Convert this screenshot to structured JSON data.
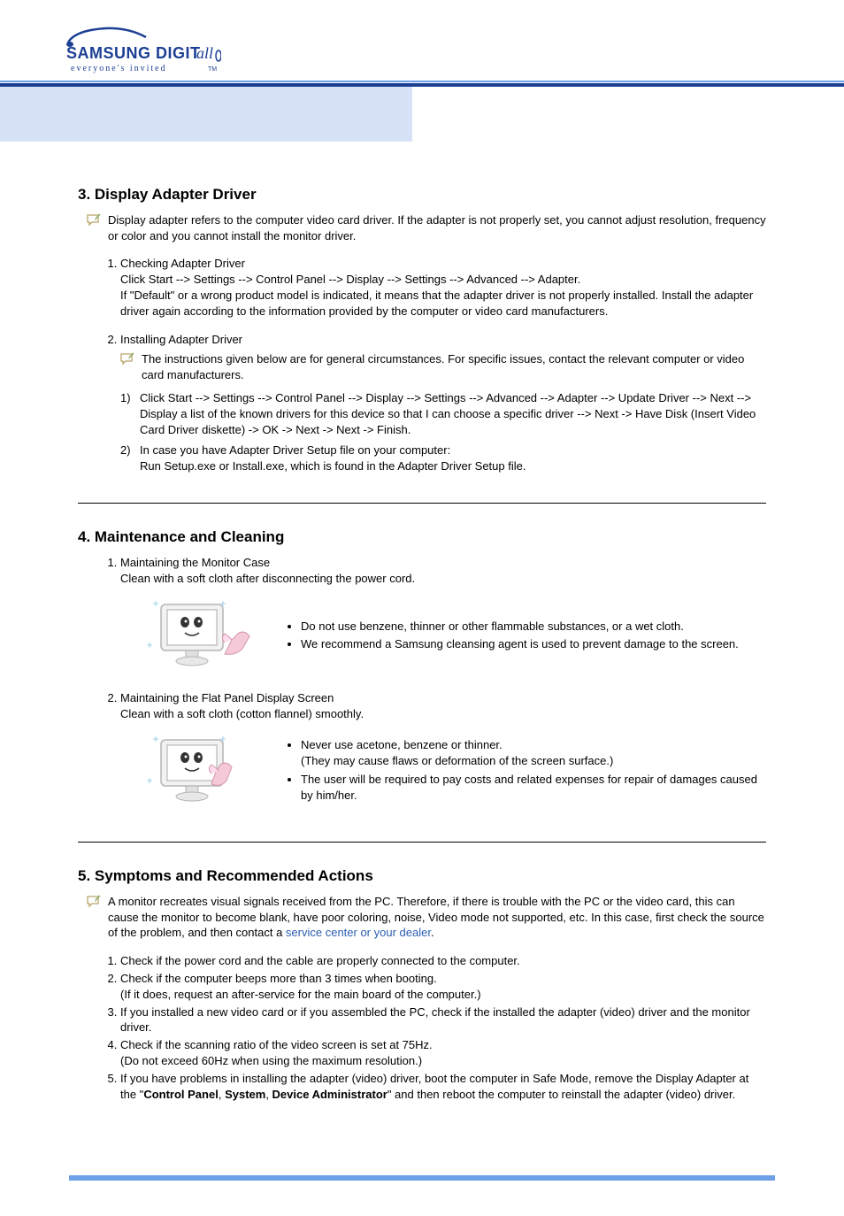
{
  "brand": {
    "line1": "SAMSUNG DIGIT",
    "line2_ital": "all",
    "tagline": "everyone's invited™"
  },
  "section3": {
    "title": "3. Display Adapter Driver",
    "note": "Display adapter refers to the computer video card driver. If the adapter is not properly set, you cannot adjust resolution, frequency or color and you cannot install the monitor driver.",
    "item1_title": "Checking Adapter Driver",
    "item1_body": "Click Start --> Settings --> Control Panel --> Display --> Settings --> Advanced --> Adapter.\nIf \"Default\" or a wrong product model is indicated, it means that the adapter driver is not properly installed. Install the adapter driver again according to the information provided by the computer or video card manufacturers.",
    "item2_title": "Installing Adapter Driver",
    "sub_note": "The instructions given below are for general circumstances. For specific issues, contact the relevant computer or video card manufacturers.",
    "step1": "Click Start --> Settings --> Control Panel --> Display --> Settings --> Advanced --> Adapter --> Update Driver --> Next --> Display a list of the known drivers for this device so that I can choose a specific driver --> Next -> Have Disk (Insert Video Card Driver diskette) -> OK -> Next -> Next -> Finish.",
    "step2": "In case you have Adapter Driver Setup file on your computer:\nRun Setup.exe or Install.exe, which is found in the Adapter Driver Setup file."
  },
  "section4": {
    "title": "4. Maintenance and Cleaning",
    "item1_title": "Maintaining the Monitor Case",
    "item1_body": "Clean with a soft cloth after disconnecting the power cord.",
    "bullets1": [
      "Do not use benzene, thinner or other flammable substances, or a wet cloth.",
      "We recommend a Samsung cleansing agent is used to prevent damage to the screen."
    ],
    "item2_title": "Maintaining the Flat Panel Display Screen",
    "item2_body": "Clean with a soft cloth (cotton flannel) smoothly.",
    "bullets2": [
      "Never use acetone, benzene or thinner.\n(They may cause flaws or deformation of the screen surface.)",
      "The user will be required to pay costs and related expenses for repair of damages caused by him/her."
    ]
  },
  "section5": {
    "title": "5. Symptoms and Recommended Actions",
    "note_pre": "A monitor recreates visual signals received from the PC. Therefore, if there is trouble with the PC or the video card, this can cause the monitor to become blank, have poor coloring, noise, Video mode not supported, etc. In this case, first check the source of the problem, and then contact a ",
    "note_link": "service center or your dealer",
    "note_post": ".",
    "items": [
      "Check if the power cord and the cable are properly connected to the computer.",
      "Check if the computer beeps more than 3 times when booting.\n(If it does, request an after-service for the main board of the computer.)",
      "If you installed a new video card or if you assembled the PC, check if the installed the adapter (video) driver and the monitor driver.",
      "Check if the scanning ratio of the video screen is set at 75Hz.\n(Do not exceed 60Hz when using the maximum resolution.)"
    ],
    "item5_pre": "If you have problems in installing the adapter (video) driver, boot the computer in Safe Mode, remove the Display Adapter at the \"",
    "item5_b1": "Control Panel",
    "item5_s1": ", ",
    "item5_b2": "System",
    "item5_s2": ", ",
    "item5_b3": "Device Administrator",
    "item5_post": "\" and then reboot the computer to reinstall the adapter (video) driver."
  }
}
